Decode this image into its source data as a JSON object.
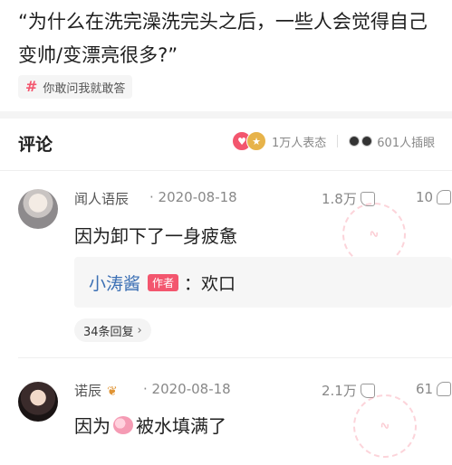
{
  "question": {
    "title": "“为什么在洗完澡洗完头之后，一些人会觉得自己变帅/变漂亮很多?”",
    "topic_tag": "你敢问我就敢答"
  },
  "comments_header": {
    "title": "评论",
    "reactions_count": "1万人表态",
    "watching_count": "601人插眼"
  },
  "comments": [
    {
      "username": "闻人语辰",
      "timestamp": "2020-08-18",
      "likes": "1.8万",
      "dislikes": "10",
      "text": "因为卸下了一身疲惫",
      "reply": {
        "name": "小涛酱",
        "badge": "作者",
        "text": "：欢口"
      },
      "more_replies": "34条回复"
    },
    {
      "username": "诺辰",
      "timestamp": "2020-08-18",
      "likes": "2.1万",
      "dislikes": "61",
      "text_before": "因为",
      "text_after": "被水填满了"
    }
  ],
  "colors": {
    "accent": "#f3566e",
    "reply_name": "#3b6fb4"
  },
  "icons": [
    "hash-icon",
    "heart-react-icon",
    "medal-react-icon",
    "eyes-icon",
    "thumb-up-icon",
    "thumb-down-icon",
    "leaf-icon",
    "brain-emoji-icon",
    "chevron-right-icon"
  ]
}
